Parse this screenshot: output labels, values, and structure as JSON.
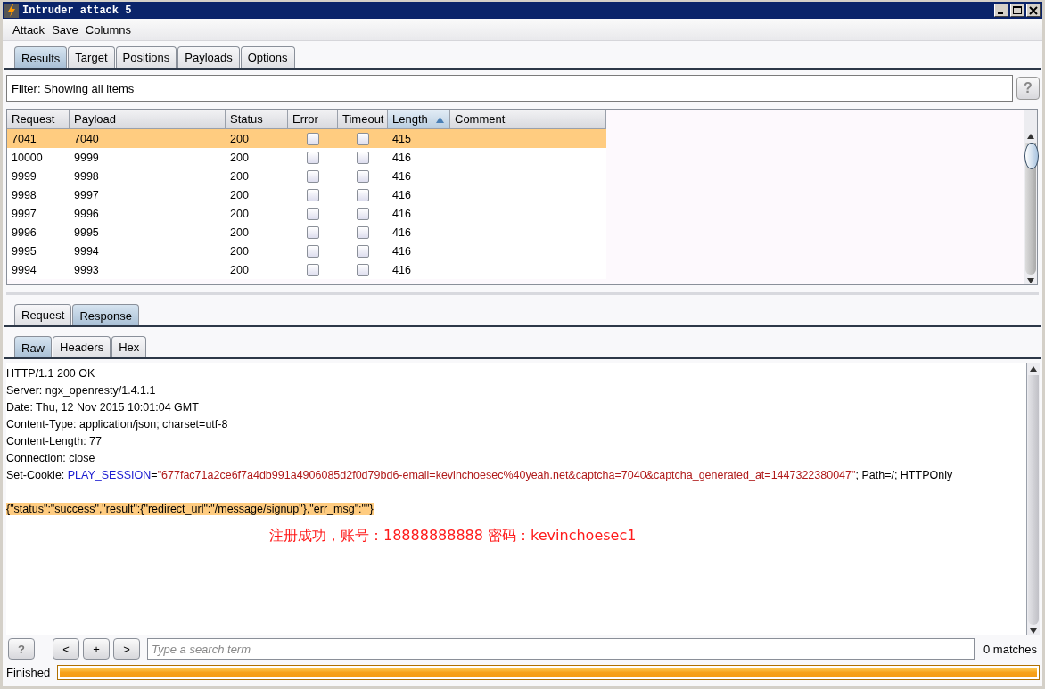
{
  "window": {
    "title": "Intruder attack 5"
  },
  "menu": [
    "Attack",
    "Save",
    "Columns"
  ],
  "tabs": [
    {
      "label": "Results",
      "selected": true
    },
    {
      "label": "Target",
      "selected": false
    },
    {
      "label": "Positions",
      "selected": false
    },
    {
      "label": "Payloads",
      "selected": false
    },
    {
      "label": "Options",
      "selected": false
    }
  ],
  "filter": {
    "text": "Filter: Showing all items",
    "help": "?"
  },
  "table": {
    "columns": [
      {
        "label": "Request",
        "sorted": false
      },
      {
        "label": "Payload",
        "sorted": false
      },
      {
        "label": "Status",
        "sorted": false
      },
      {
        "label": "Error",
        "sorted": false
      },
      {
        "label": "Timeout",
        "sorted": false
      },
      {
        "label": "Length",
        "sorted": true
      },
      {
        "label": "Comment",
        "sorted": false
      }
    ],
    "rows": [
      {
        "request": "7041",
        "payload": "7040",
        "status": "200",
        "error": false,
        "timeout": false,
        "length": "415",
        "selected": true
      },
      {
        "request": "10000",
        "payload": "9999",
        "status": "200",
        "error": false,
        "timeout": false,
        "length": "416",
        "selected": false
      },
      {
        "request": "9999",
        "payload": "9998",
        "status": "200",
        "error": false,
        "timeout": false,
        "length": "416",
        "selected": false
      },
      {
        "request": "9998",
        "payload": "9997",
        "status": "200",
        "error": false,
        "timeout": false,
        "length": "416",
        "selected": false
      },
      {
        "request": "9997",
        "payload": "9996",
        "status": "200",
        "error": false,
        "timeout": false,
        "length": "416",
        "selected": false
      },
      {
        "request": "9996",
        "payload": "9995",
        "status": "200",
        "error": false,
        "timeout": false,
        "length": "416",
        "selected": false
      },
      {
        "request": "9995",
        "payload": "9994",
        "status": "200",
        "error": false,
        "timeout": false,
        "length": "416",
        "selected": false
      },
      {
        "request": "9994",
        "payload": "9993",
        "status": "200",
        "error": false,
        "timeout": false,
        "length": "416",
        "selected": false
      }
    ]
  },
  "message_tabs": [
    {
      "label": "Request",
      "selected": false
    },
    {
      "label": "Response",
      "selected": true
    }
  ],
  "view_tabs": [
    {
      "label": "Raw",
      "selected": true
    },
    {
      "label": "Headers",
      "selected": false
    },
    {
      "label": "Hex",
      "selected": false
    }
  ],
  "response": {
    "headers": [
      {
        "highlighted": false,
        "parts": [
          {
            "kind": "plain",
            "text": "HTTP/1.1 200 OK"
          }
        ]
      },
      {
        "highlighted": false,
        "parts": [
          {
            "kind": "plain",
            "text": "Server: ngx_openresty/1.4.1.1"
          }
        ]
      },
      {
        "highlighted": false,
        "parts": [
          {
            "kind": "plain",
            "text": "Date: Thu, 12 Nov 2015 10:01:04 GMT"
          }
        ]
      },
      {
        "highlighted": false,
        "parts": [
          {
            "kind": "plain",
            "text": "Content-Type: application/json; charset=utf-8"
          }
        ]
      },
      {
        "highlighted": false,
        "parts": [
          {
            "kind": "plain",
            "text": "Content-Length: 77"
          }
        ]
      },
      {
        "highlighted": false,
        "parts": [
          {
            "kind": "plain",
            "text": "Connection: close"
          }
        ]
      },
      {
        "highlighted": false,
        "parts": [
          {
            "kind": "plain",
            "text": "Set-Cookie: "
          },
          {
            "kind": "name",
            "text": "PLAY_SESSION"
          },
          {
            "kind": "plain",
            "text": "="
          },
          {
            "kind": "value",
            "text": "\"677fac71a2ce6f7a4db991a4906085d2f0d79bd6-email=kevinchoesec%40yeah.net&captcha=7040&captcha_generated_at=1447322380047\""
          },
          {
            "kind": "plain",
            "text": "; Path=/; HTTPOnly"
          }
        ]
      }
    ],
    "body": [
      {
        "highlighted": true,
        "parts": [
          {
            "kind": "plain",
            "text": "{\"status\":\"success\",\"result\":{\"redirect_url\":\"/message/signup\"},\"err_msg\":\"\"}"
          }
        ]
      }
    ]
  },
  "annotation": "注册成功，账号：18888888888 密码：kevinchoesec1",
  "search": {
    "help": "?",
    "prev": "<",
    "add": "+",
    "next": ">",
    "placeholder": "Type a search term",
    "matches": "0 matches"
  },
  "status": {
    "text": "Finished",
    "progress": {
      "level": 1
    }
  }
}
